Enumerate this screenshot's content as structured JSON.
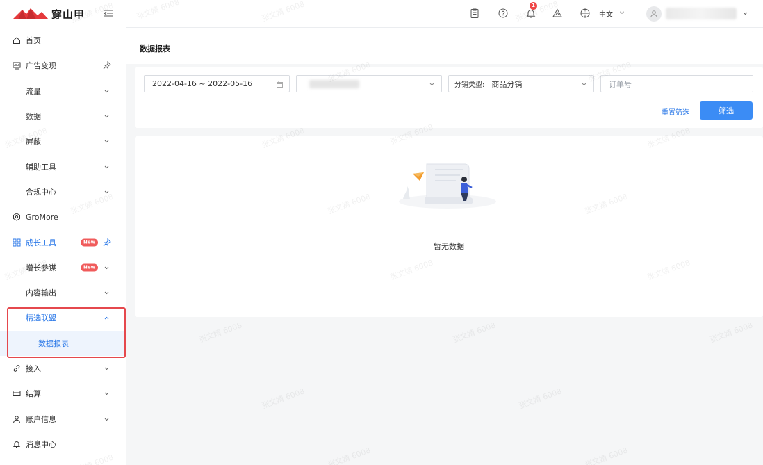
{
  "brand": {
    "name": "穿山甲",
    "logo_color": "#e4393c"
  },
  "sidebar": {
    "items": [
      {
        "label": "首页",
        "icon": "home-icon"
      },
      {
        "label": "广告变现",
        "icon": "chart-icon"
      },
      {
        "label": "流量"
      },
      {
        "label": "数据"
      },
      {
        "label": "屏蔽"
      },
      {
        "label": "辅助工具"
      },
      {
        "label": "合规中心"
      },
      {
        "label": "GroMore",
        "icon": "gromore-icon"
      },
      {
        "label": "成长工具",
        "icon": "grid-icon",
        "badge": "New"
      },
      {
        "label": "增长参谋",
        "badge": "New"
      },
      {
        "label": "内容输出"
      },
      {
        "label": "精选联盟"
      },
      {
        "label": "数据报表"
      },
      {
        "label": "接入",
        "icon": "link-icon"
      },
      {
        "label": "结算",
        "icon": "card-icon"
      },
      {
        "label": "账户信息",
        "icon": "user-icon"
      },
      {
        "label": "消息中心",
        "icon": "bell-icon"
      }
    ]
  },
  "topbar": {
    "notification_count": "1",
    "language": "中文"
  },
  "page": {
    "title": "数据报表"
  },
  "filters": {
    "date_range": "2022-04-16 ~ 2022-05-16",
    "distribution_type_label": "分销类型:",
    "distribution_type_value": "商品分销",
    "order_placeholder": "订单号",
    "reset_label": "重置筛选",
    "submit_label": "筛选"
  },
  "empty": {
    "message": "暂无数据"
  },
  "watermark": "张文婧 6008",
  "colors": {
    "accent": "#3b8cf5",
    "highlight": "#e5484d",
    "badge": "#f05b5b"
  }
}
